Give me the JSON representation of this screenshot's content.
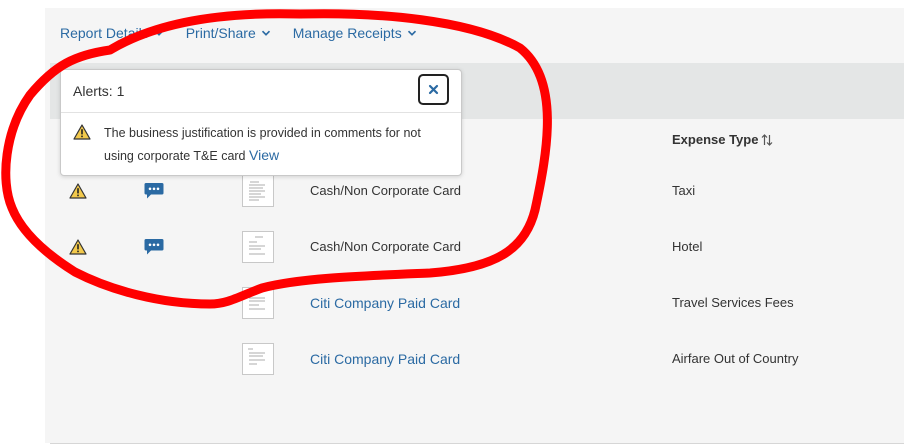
{
  "nav": {
    "items": [
      {
        "label": "Report Details"
      },
      {
        "label": "Print/Share"
      },
      {
        "label": "Manage Receipts"
      }
    ]
  },
  "table": {
    "header": {
      "expense_type": "Expense Type"
    },
    "rows": [
      {
        "warning": true,
        "comment": true,
        "payment_type": "Cash/Non Corporate Card",
        "payment_link": false,
        "expense_type": "Taxi"
      },
      {
        "warning": true,
        "comment": true,
        "payment_type": "Cash/Non Corporate Card",
        "payment_link": false,
        "expense_type": "Hotel"
      },
      {
        "warning": false,
        "comment": false,
        "payment_type": "Citi Company Paid Card",
        "payment_link": true,
        "expense_type": "Travel Services Fees"
      },
      {
        "warning": false,
        "comment": false,
        "payment_type": "Citi Company Paid Card",
        "payment_link": true,
        "expense_type": "Airfare Out of Country"
      }
    ]
  },
  "alert": {
    "title": "Alerts: 1",
    "message": "The business justification is provided in comments for not using corporate T&E card",
    "link": "View"
  },
  "colors": {
    "link": "#2b6aa3",
    "warning": "#f2c94c",
    "comment": "#2b6aa3",
    "annotation": "#ff0000"
  }
}
